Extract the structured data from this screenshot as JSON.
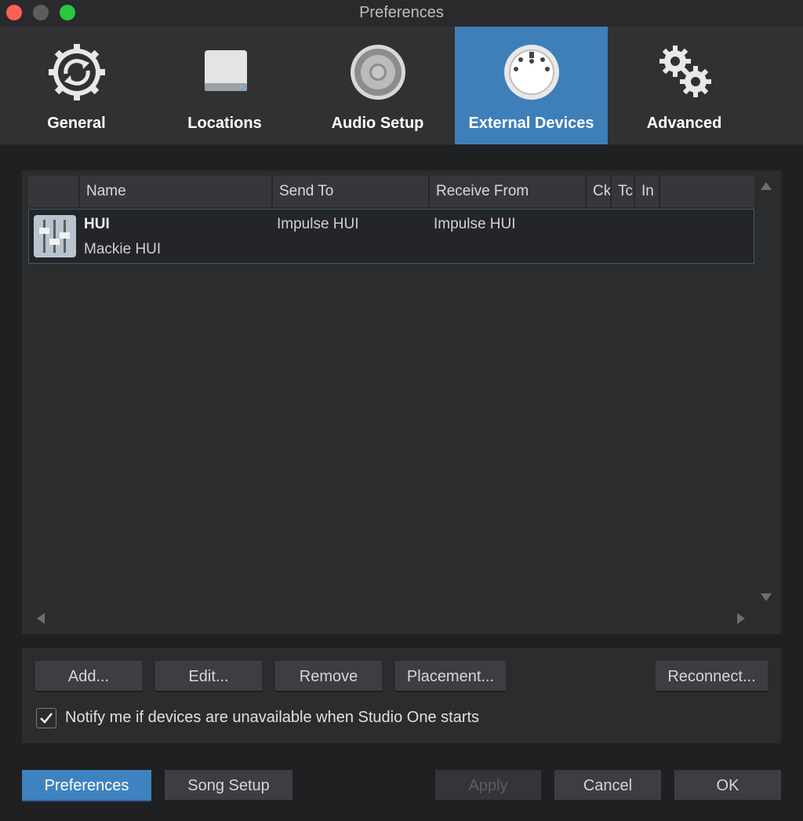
{
  "window": {
    "title": "Preferences"
  },
  "tabs": [
    {
      "label": "General",
      "icon": "sync-gear-icon"
    },
    {
      "label": "Locations",
      "icon": "hard-drive-icon"
    },
    {
      "label": "Audio Setup",
      "icon": "speaker-icon"
    },
    {
      "label": "External Devices",
      "icon": "midi-connector-icon",
      "active": true
    },
    {
      "label": "Advanced",
      "icon": "gears-icon"
    }
  ],
  "device_table": {
    "columns": [
      "Name",
      "Send To",
      "Receive From",
      "Ck",
      "Tc",
      "In"
    ],
    "rows": [
      {
        "name": "HUI",
        "model": "Mackie HUI",
        "send_to": "Impulse HUI",
        "receive_from": "Impulse HUI",
        "icon": "mixer-fader-icon"
      }
    ]
  },
  "device_actions": {
    "add": "Add...",
    "edit": "Edit...",
    "remove": "Remove",
    "placement": "Placement...",
    "reconnect": "Reconnect..."
  },
  "notify": {
    "label": "Notify me if devices are unavailable when Studio One starts",
    "checked": true
  },
  "footer": {
    "preferences": "Preferences",
    "song_setup": "Song Setup",
    "apply": "Apply",
    "cancel": "Cancel",
    "ok": "OK"
  },
  "colors": {
    "accent": "#3e7fba",
    "background": "#1f2022",
    "panel": "#2b2c2e"
  }
}
